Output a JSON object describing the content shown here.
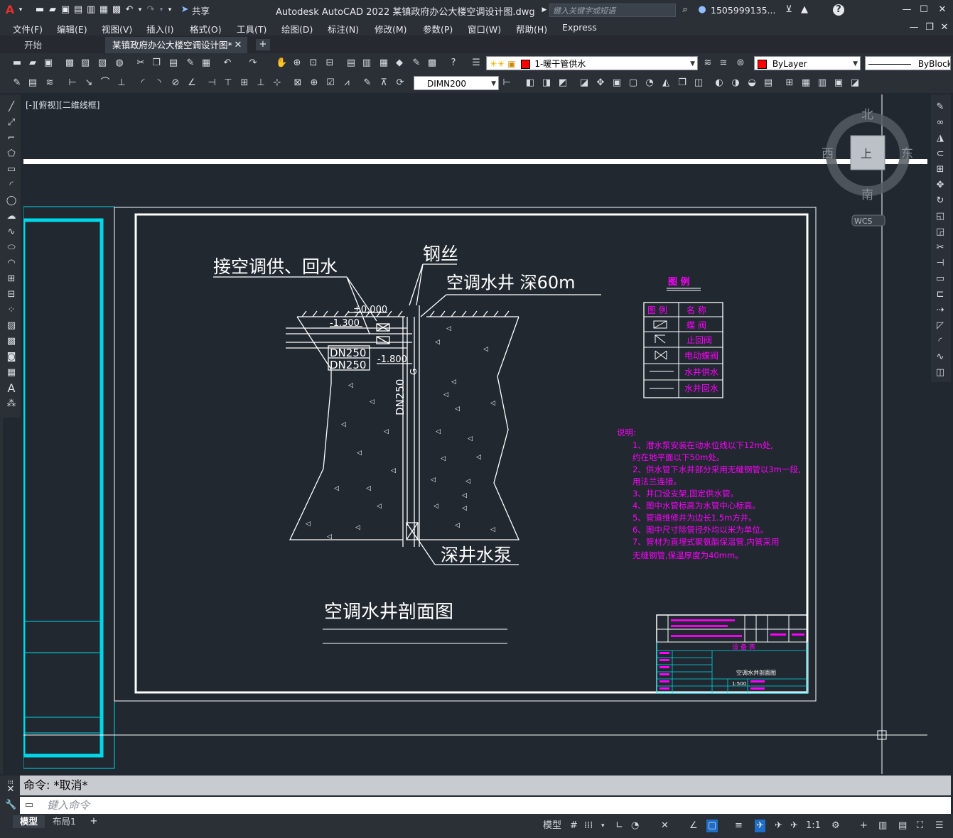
{
  "window": {
    "app_title": "Autodesk AutoCAD 2022   某镇政府办公大楼空调设计图.dwg",
    "share_label": "共享",
    "search_placeholder": "键入关键字或短语",
    "user_name": "1505999135...",
    "help_label": "?"
  },
  "menu": [
    "文件(F)",
    "编辑(E)",
    "视图(V)",
    "插入(I)",
    "格式(O)",
    "工具(T)",
    "绘图(D)",
    "标注(N)",
    "修改(M)",
    "参数(P)",
    "窗口(W)",
    "帮助(H)",
    "Express"
  ],
  "tabs": {
    "start": "开始",
    "active": "某镇政府办公大楼空调设计图*",
    "add": "+"
  },
  "toolbar": {
    "layer_value": "1-暖干管供水",
    "color_value": "ByLayer",
    "linetype_value": "ByBlock",
    "dimstyle_value": "DIMN200"
  },
  "viewport": {
    "label": "[-][俯视][二维线框]"
  },
  "viewcube": {
    "north": "北",
    "south": "南",
    "east": "东",
    "west": "西",
    "top": "上",
    "wcs": "WCS"
  },
  "drawing": {
    "label_supply_return": "接空调供、回水",
    "label_steel_wire": "钢丝",
    "label_well": "空调水井  深60m",
    "label_pump": "深井水泵",
    "title": "空调水井剖面图",
    "elev_0": "±0.000",
    "elev_1300": "-1.300",
    "elev_1800": "-1.800",
    "dn250_a": "DN250",
    "dn250_b": "DN250",
    "dn250_v": "DN250",
    "pipe_g": "G",
    "legend_title": "图  例",
    "legend_header_symbol": "图  例",
    "legend_header_name": "名  称",
    "legend_items": [
      "蝶  阀",
      "止回阀",
      "电动蝶阀",
      "水井供水",
      "水井回水"
    ],
    "notes_title": "说明:",
    "notes": [
      "1、潜水泵安装在动水位线以下12m处,",
      "   约在地平面以下50m处。",
      "2、供水管下水井部分采用无缝钢管以3m一段,",
      "   用法兰连接。",
      "3、井口设支架,固定供水管。",
      "4、图中水管标高为水管中心标高。",
      "5、管道维修井为边长1.5m方井。",
      "6、图中尺寸除管径外均以米为单位。",
      "7、管材为直埋式聚氨酯保温管,内管采用",
      "   无缝钢管,保温厚度为40mm。"
    ],
    "titleblock_sheet": "空调水井剖面图",
    "titleblock_header": "设  备  表",
    "titleblock_scale": "1:500"
  },
  "command": {
    "history": "命令: *取消*",
    "placeholder": "键入命令"
  },
  "status": {
    "model_tab": "模型",
    "layout_tab": "布局1",
    "model_label": "模型",
    "scale": "1:1"
  },
  "colors": {
    "canvas_bg": "#212830",
    "cyan": "#00d8e8",
    "magenta": "#ff00ff",
    "white": "#ffffff"
  }
}
